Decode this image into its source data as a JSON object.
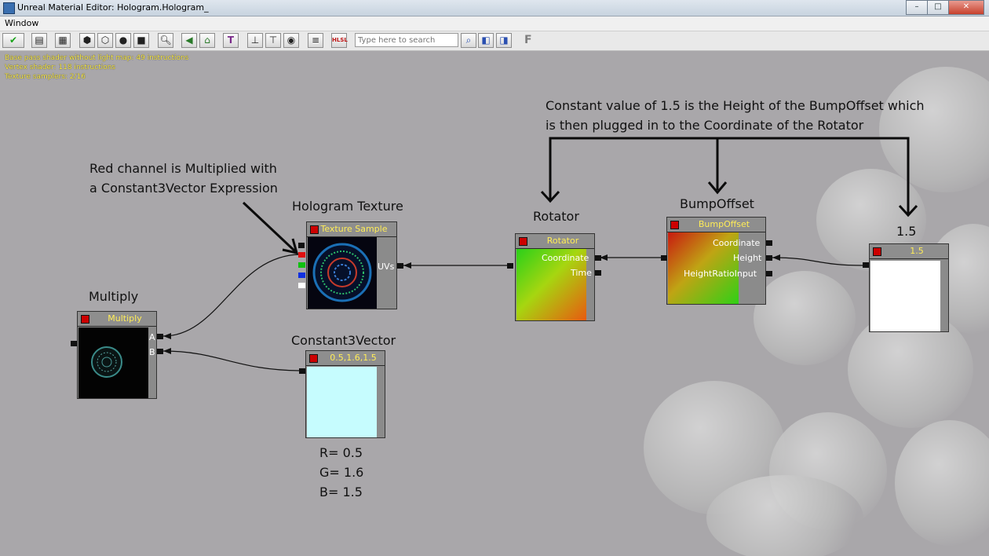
{
  "window": {
    "title": "Unreal Material Editor: Hologram.Hologram_",
    "controls": [
      "–",
      "□",
      "✕"
    ]
  },
  "menu": [
    "Window"
  ],
  "toolbar": {
    "search_placeholder": "Type here to search",
    "hlsl_label": "HLSL",
    "f_label": "F"
  },
  "stats": [
    "Base pass shader without light map: 49 instructions",
    "Vertex shader: 118 instructions",
    "Texture samplers: 2/16"
  ],
  "annotations": {
    "height_note_line1": "Constant value of 1.5 is the Height of the BumpOffset which",
    "height_note_line2": "is then plugged in to the Coordinate of the Rotator",
    "multiply_note_line1": "Red channel is Multiplied with",
    "multiply_note_line2": "a Constant3Vector Expression",
    "hologram_texture": "Hologram Texture",
    "rotator": "Rotator",
    "bumpoffset": "BumpOffset",
    "constant_value": "1.5",
    "multiply": "Multiply",
    "constant3vector": "Constant3Vector",
    "r_value": "R= 0.5",
    "g_value": "G= 1.6",
    "b_value": "B= 1.5"
  },
  "nodes": {
    "texture_sample": {
      "header": "Texture Sample",
      "output": "UVs"
    },
    "rotator": {
      "header": "Rotator",
      "inputs": [
        "Coordinate",
        "Time"
      ]
    },
    "bumpoffset": {
      "header": "BumpOffset",
      "inputs": [
        "Coordinate",
        "Height",
        "HeightRatioInput"
      ]
    },
    "constant": {
      "header": "1.5"
    },
    "multiply": {
      "header": "Multiply",
      "inputs": [
        "A",
        "B"
      ]
    },
    "constant3vector": {
      "header": "0.5,1.6,1.5"
    }
  },
  "colors": {
    "background": "#a9a7aa",
    "header_text": "#ffed57",
    "constant3vector_preview": "#c6fcfe"
  }
}
